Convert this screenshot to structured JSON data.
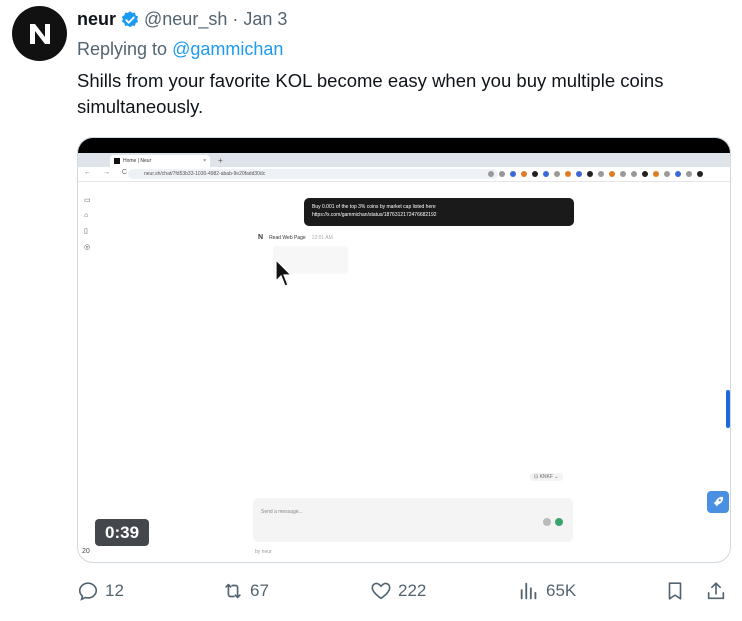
{
  "author": {
    "name": "neur",
    "handle": "@neur_sh",
    "separator": "·",
    "date": "Jan 3",
    "verified": true,
    "avatar_icon": "neur-logo-icon"
  },
  "reply": {
    "prefix": "Replying to",
    "to": "@gammichan"
  },
  "tweet": {
    "text": "Shills from your favorite KOL become easy when you buy multiple coins simultaneously."
  },
  "video": {
    "duration": "0:39",
    "browser": {
      "tab_title": "Home | Neur",
      "tab_close": "×",
      "tab_plus": "+",
      "nav": "← → C",
      "url": "neur.sh/chat/7fd53b33-1030-4982-abab-9e20fadd30dc"
    },
    "user_message_line1": "Buy 0.001 of the top 3% coins by market cap listed here",
    "user_message_line2": "https://x.com/gammichan/status/1876312172476682192",
    "agent_name": "N",
    "agent_tool": "Read Web Page",
    "agent_time": "12:01 AM",
    "model_label": "⊡ KNKF ⌄",
    "input_placeholder": "Send a message...",
    "footer_text": "by neur",
    "corner_number": "20"
  },
  "actions": {
    "reply_count": "12",
    "retweet_count": "67",
    "like_count": "222",
    "views_count": "65K"
  },
  "colors": {
    "accent": "#1d9bf0",
    "muted": "#536471",
    "text": "#0f1419"
  }
}
